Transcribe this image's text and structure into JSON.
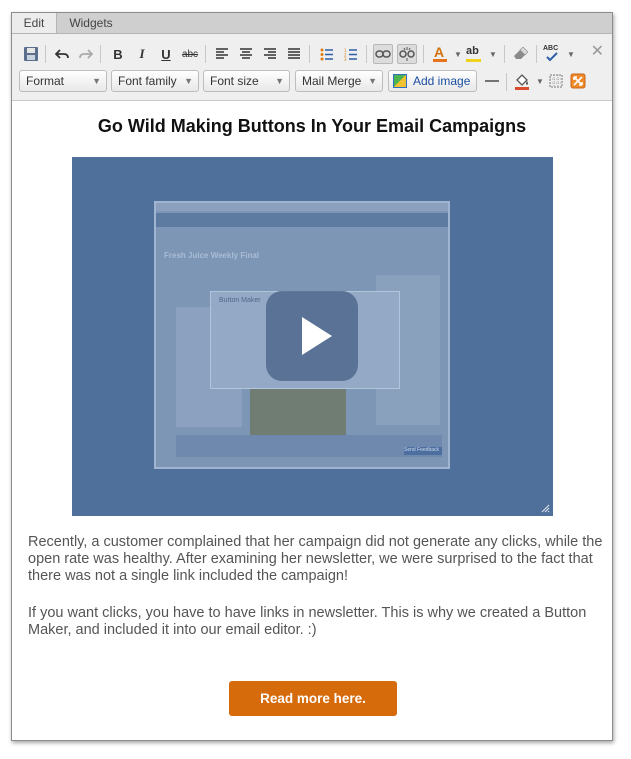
{
  "tabs": [
    {
      "label": "Edit",
      "active": true
    },
    {
      "label": "Widgets",
      "active": false
    }
  ],
  "toolbar": {
    "row1_icons": [
      "save-icon",
      "undo-icon",
      "redo-icon",
      "bold-icon",
      "italic-icon",
      "underline-icon",
      "strikethrough-icon",
      "align-left-icon",
      "align-center-icon",
      "align-right-icon",
      "align-justify-icon",
      "bullet-list-icon",
      "numbered-list-icon",
      "link-icon",
      "unlink-icon",
      "text-color-icon",
      "highlight-color-icon",
      "eraser-icon",
      "spellcheck-icon",
      "close-icon"
    ],
    "bold": "B",
    "italic": "I",
    "underline": "U",
    "strike": "abc",
    "text_color_glyph": "A",
    "highlight_glyph": "ab",
    "spell_glyph": "ABC",
    "close": "✕",
    "format": "Format",
    "font_family": "Font family",
    "font_size": "Font size",
    "mail_merge": "Mail Merge",
    "add_image": "Add image"
  },
  "content": {
    "title": "Go Wild Making Buttons In Your Email Campaigns",
    "video_thumb": {
      "browser_title": "Fresh Juice Weekly Final",
      "dialog_title": "Button Maker",
      "footer_button": "Send Feedback"
    },
    "paragraph1": "Recently, a customer complained that her campaign did not generate any clicks, while the open rate was healthy. After examining her newsletter, we were surprised to the fact that there was not a single link included the campaign!",
    "paragraph2": "If you want clicks, you have to have links in newsletter. This is why we created a Button Maker, and included it into our email editor. :)",
    "cta": "Read more here."
  },
  "colors": {
    "cta": "#d66b0c",
    "video_bg": "#50709c",
    "link_blue": "#1a4fa0"
  }
}
